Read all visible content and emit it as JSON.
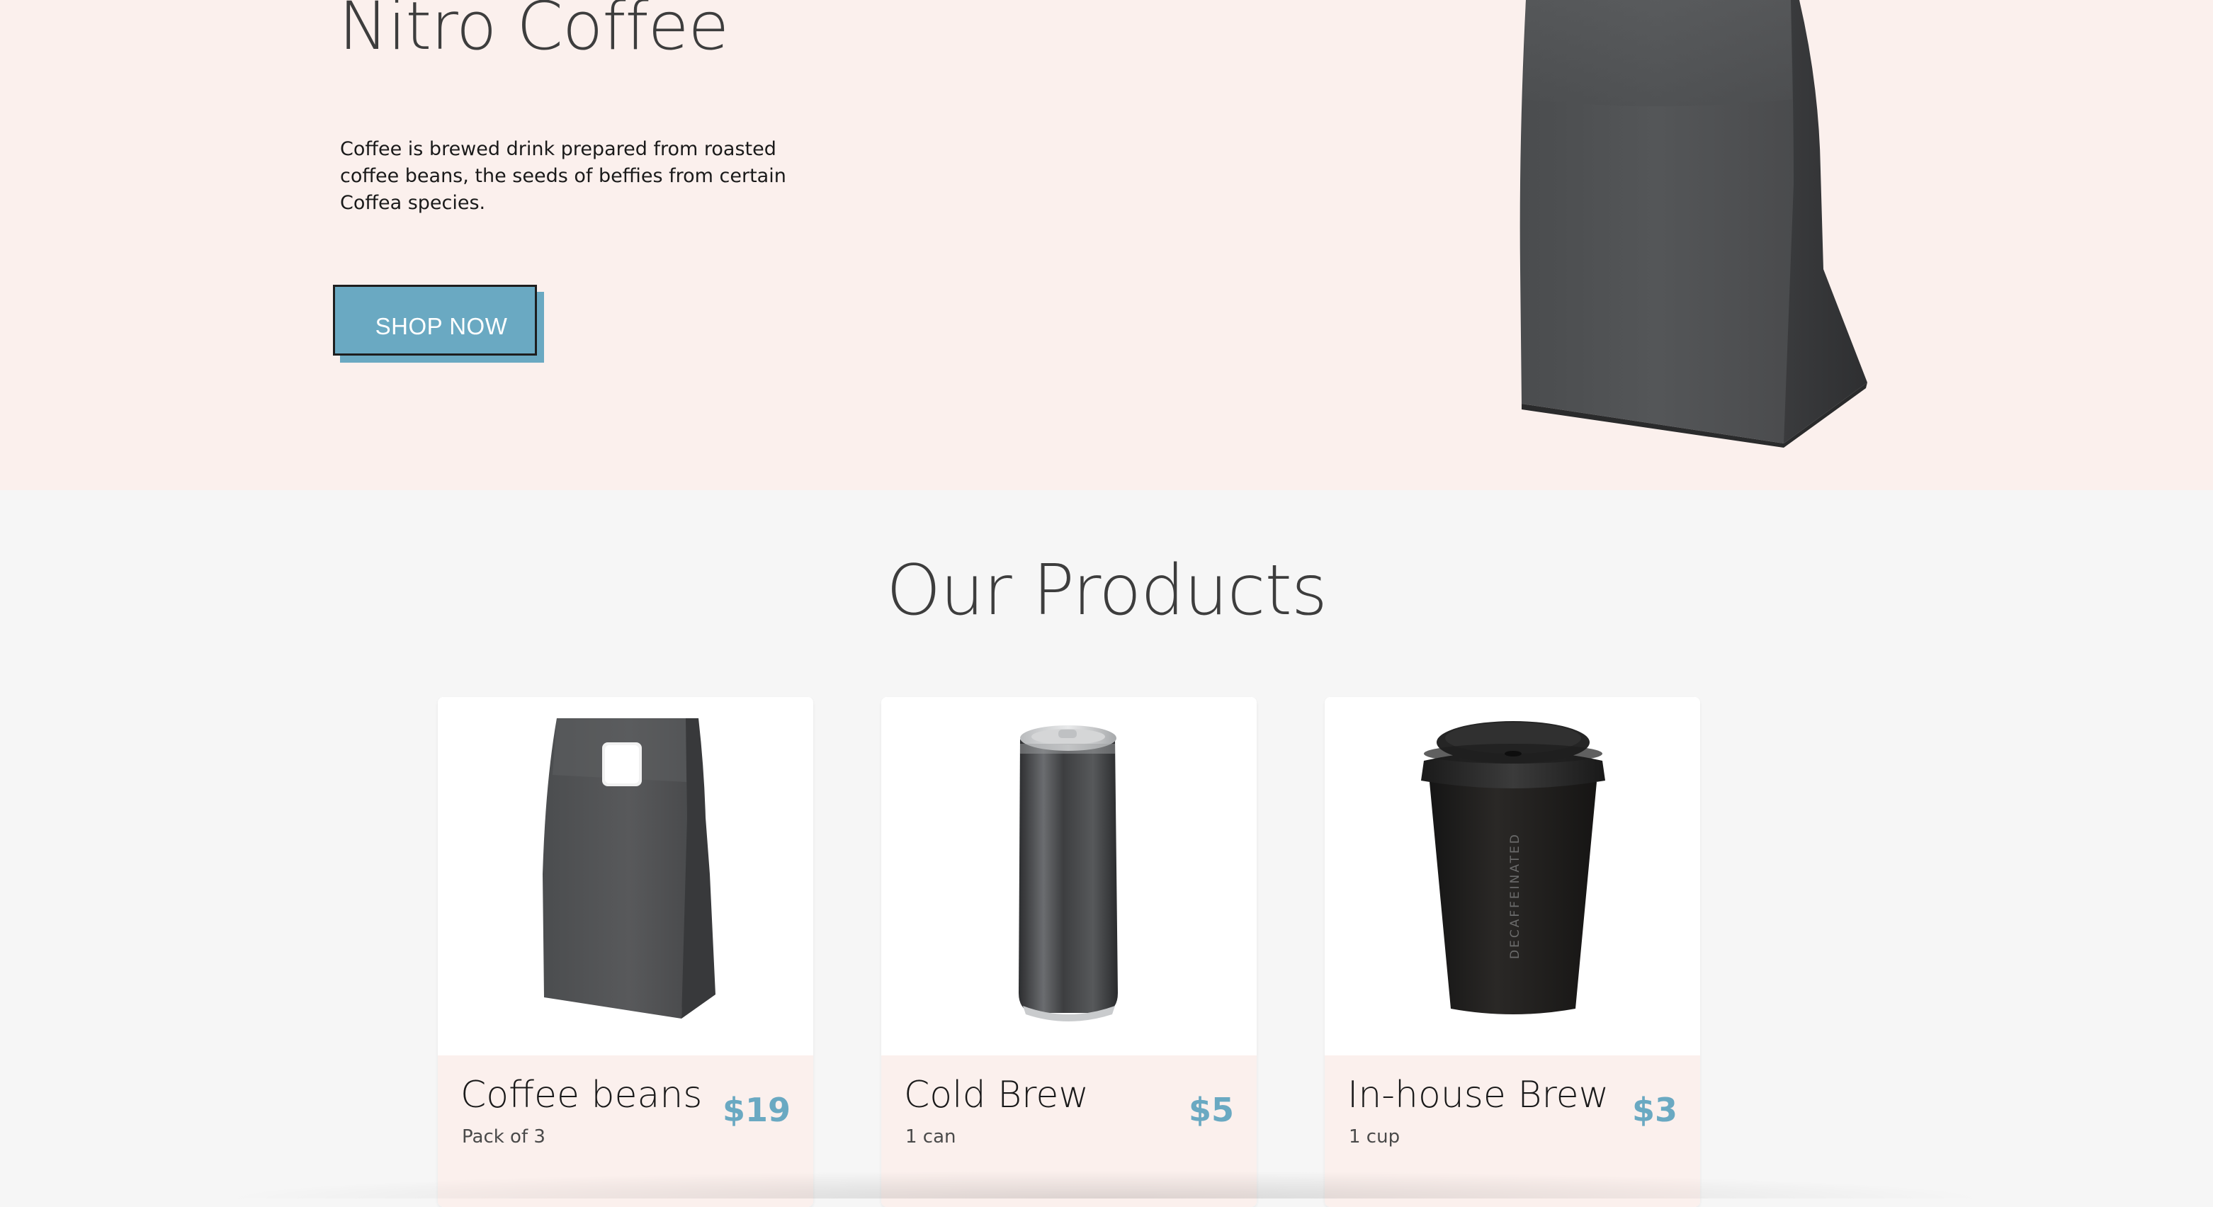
{
  "hero": {
    "title": "Nitro Coffee",
    "description": "Coffee is brewed drink prepared from roasted coffee beans, the seeds of beffies from certain Coffea species.",
    "cta_label": "SHOP NOW",
    "image_icon": "coffee-bag-image"
  },
  "products": {
    "title": "Our Products",
    "items": [
      {
        "name": "Coffee beans",
        "subtitle": "Pack of 3",
        "price": "$19",
        "image_icon": "coffee-bag-image"
      },
      {
        "name": "Cold Brew",
        "subtitle": "1 can",
        "price": "$5",
        "image_icon": "soda-can-image"
      },
      {
        "name": "In-house Brew",
        "subtitle": "1 cup",
        "price": "$3",
        "image_icon": "coffee-cup-image",
        "cup_print": "DECAFFEINATED"
      }
    ]
  },
  "colors": {
    "hero_bg": "#fbf0ed",
    "page_bg": "#f6f6f6",
    "accent": "#6aa9c2",
    "heading": "#3d3d3d"
  }
}
